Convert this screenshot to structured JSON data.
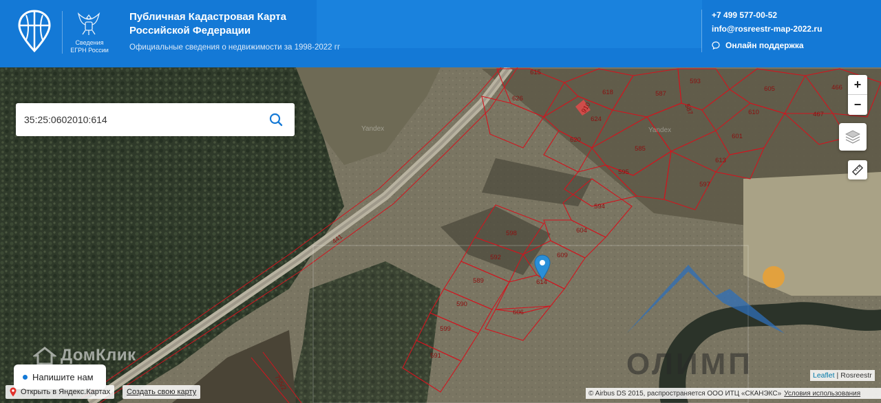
{
  "header": {
    "title": "Публичная Кадастровая Карта Российской Федерации",
    "subtitle": "Официальные сведения о недвижимости за 1998-2022 гг",
    "emblem_caption": "Сведения ЕГРН России",
    "phone": "+7 499 577-00-52",
    "email": "info@rosreestr-map-2022.ru",
    "support": "Онлайн поддержка"
  },
  "search": {
    "value": "35:25:0602010:614",
    "placeholder": ""
  },
  "map": {
    "road_label": "441",
    "road_label_2": "755/2",
    "yandex_marks": [
      "Yandex",
      "Yandex"
    ],
    "marker_parcel": "614",
    "parcels": [
      "615",
      "626",
      "618",
      "910",
      "624",
      "587",
      "593",
      "587",
      "605",
      "466",
      "610",
      "467",
      "620",
      "585",
      "601",
      "613",
      "595",
      "597",
      "594",
      "604",
      "598",
      "592",
      "609",
      "589",
      "614",
      "590",
      "606",
      "599",
      "591"
    ],
    "domclick_watermark": "ДомКлик",
    "olimp_watermark": "ОЛИМП"
  },
  "controls": {
    "zoom_in": "+",
    "zoom_out": "−"
  },
  "bottom": {
    "chat_label": "Напишите нам",
    "open_in_yandex": "Открыть в Яндекс.Картах",
    "create_map": "Создать свою карту",
    "leaflet": "Leaflet",
    "rosreestr": "Rosreestr",
    "attribution": "© Airbus DS 2015, распространяется ООО ИТЦ «СКАНЭКС»",
    "terms": "Условия использования",
    "attr_separator": "|"
  },
  "colors": {
    "header_blue": "#1479d6",
    "parcel_red": "#d2141e",
    "marker_blue": "#2a8fd8"
  }
}
